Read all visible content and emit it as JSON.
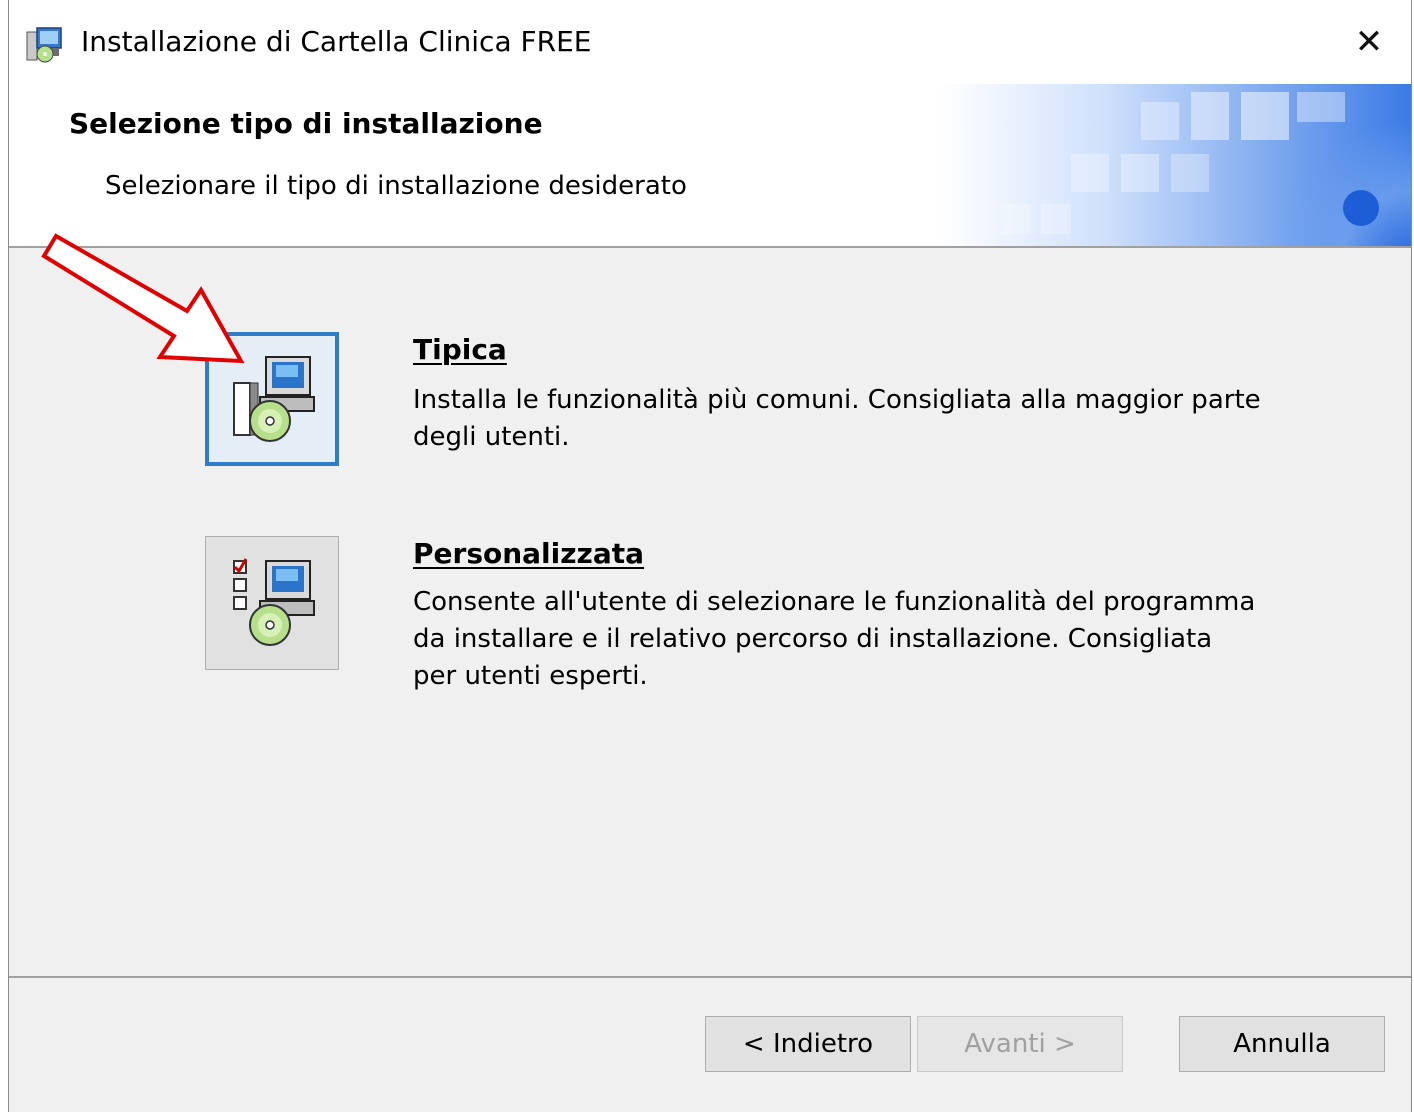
{
  "window": {
    "title": "Installazione di Cartella Clinica FREE",
    "close_glyph": "✕"
  },
  "header": {
    "title": "Selezione tipo di installazione",
    "subtitle": "Selezionare il tipo di installazione desiderato"
  },
  "options": [
    {
      "title": "Tipica",
      "description_lines": [
        "Installa le funzionalità più comuni. Consigliata alla maggior parte",
        "degli utenti."
      ],
      "icon": "typical-install-icon",
      "focused": true
    },
    {
      "title": "Personalizzata",
      "description_lines": [
        "Consente all'utente di selezionare le funzionalità del programma",
        "da installare e il relativo percorso di installazione. Consigliata",
        "per utenti esperti."
      ],
      "icon": "custom-install-icon",
      "focused": false
    }
  ],
  "buttons": {
    "back": "< Indietro",
    "next": "Avanti >",
    "cancel": "Annulla"
  },
  "colors": {
    "focus_border": "#2f7dc8",
    "annotation_arrow": "#e00000",
    "banner_blue": "#1a5fd6"
  }
}
